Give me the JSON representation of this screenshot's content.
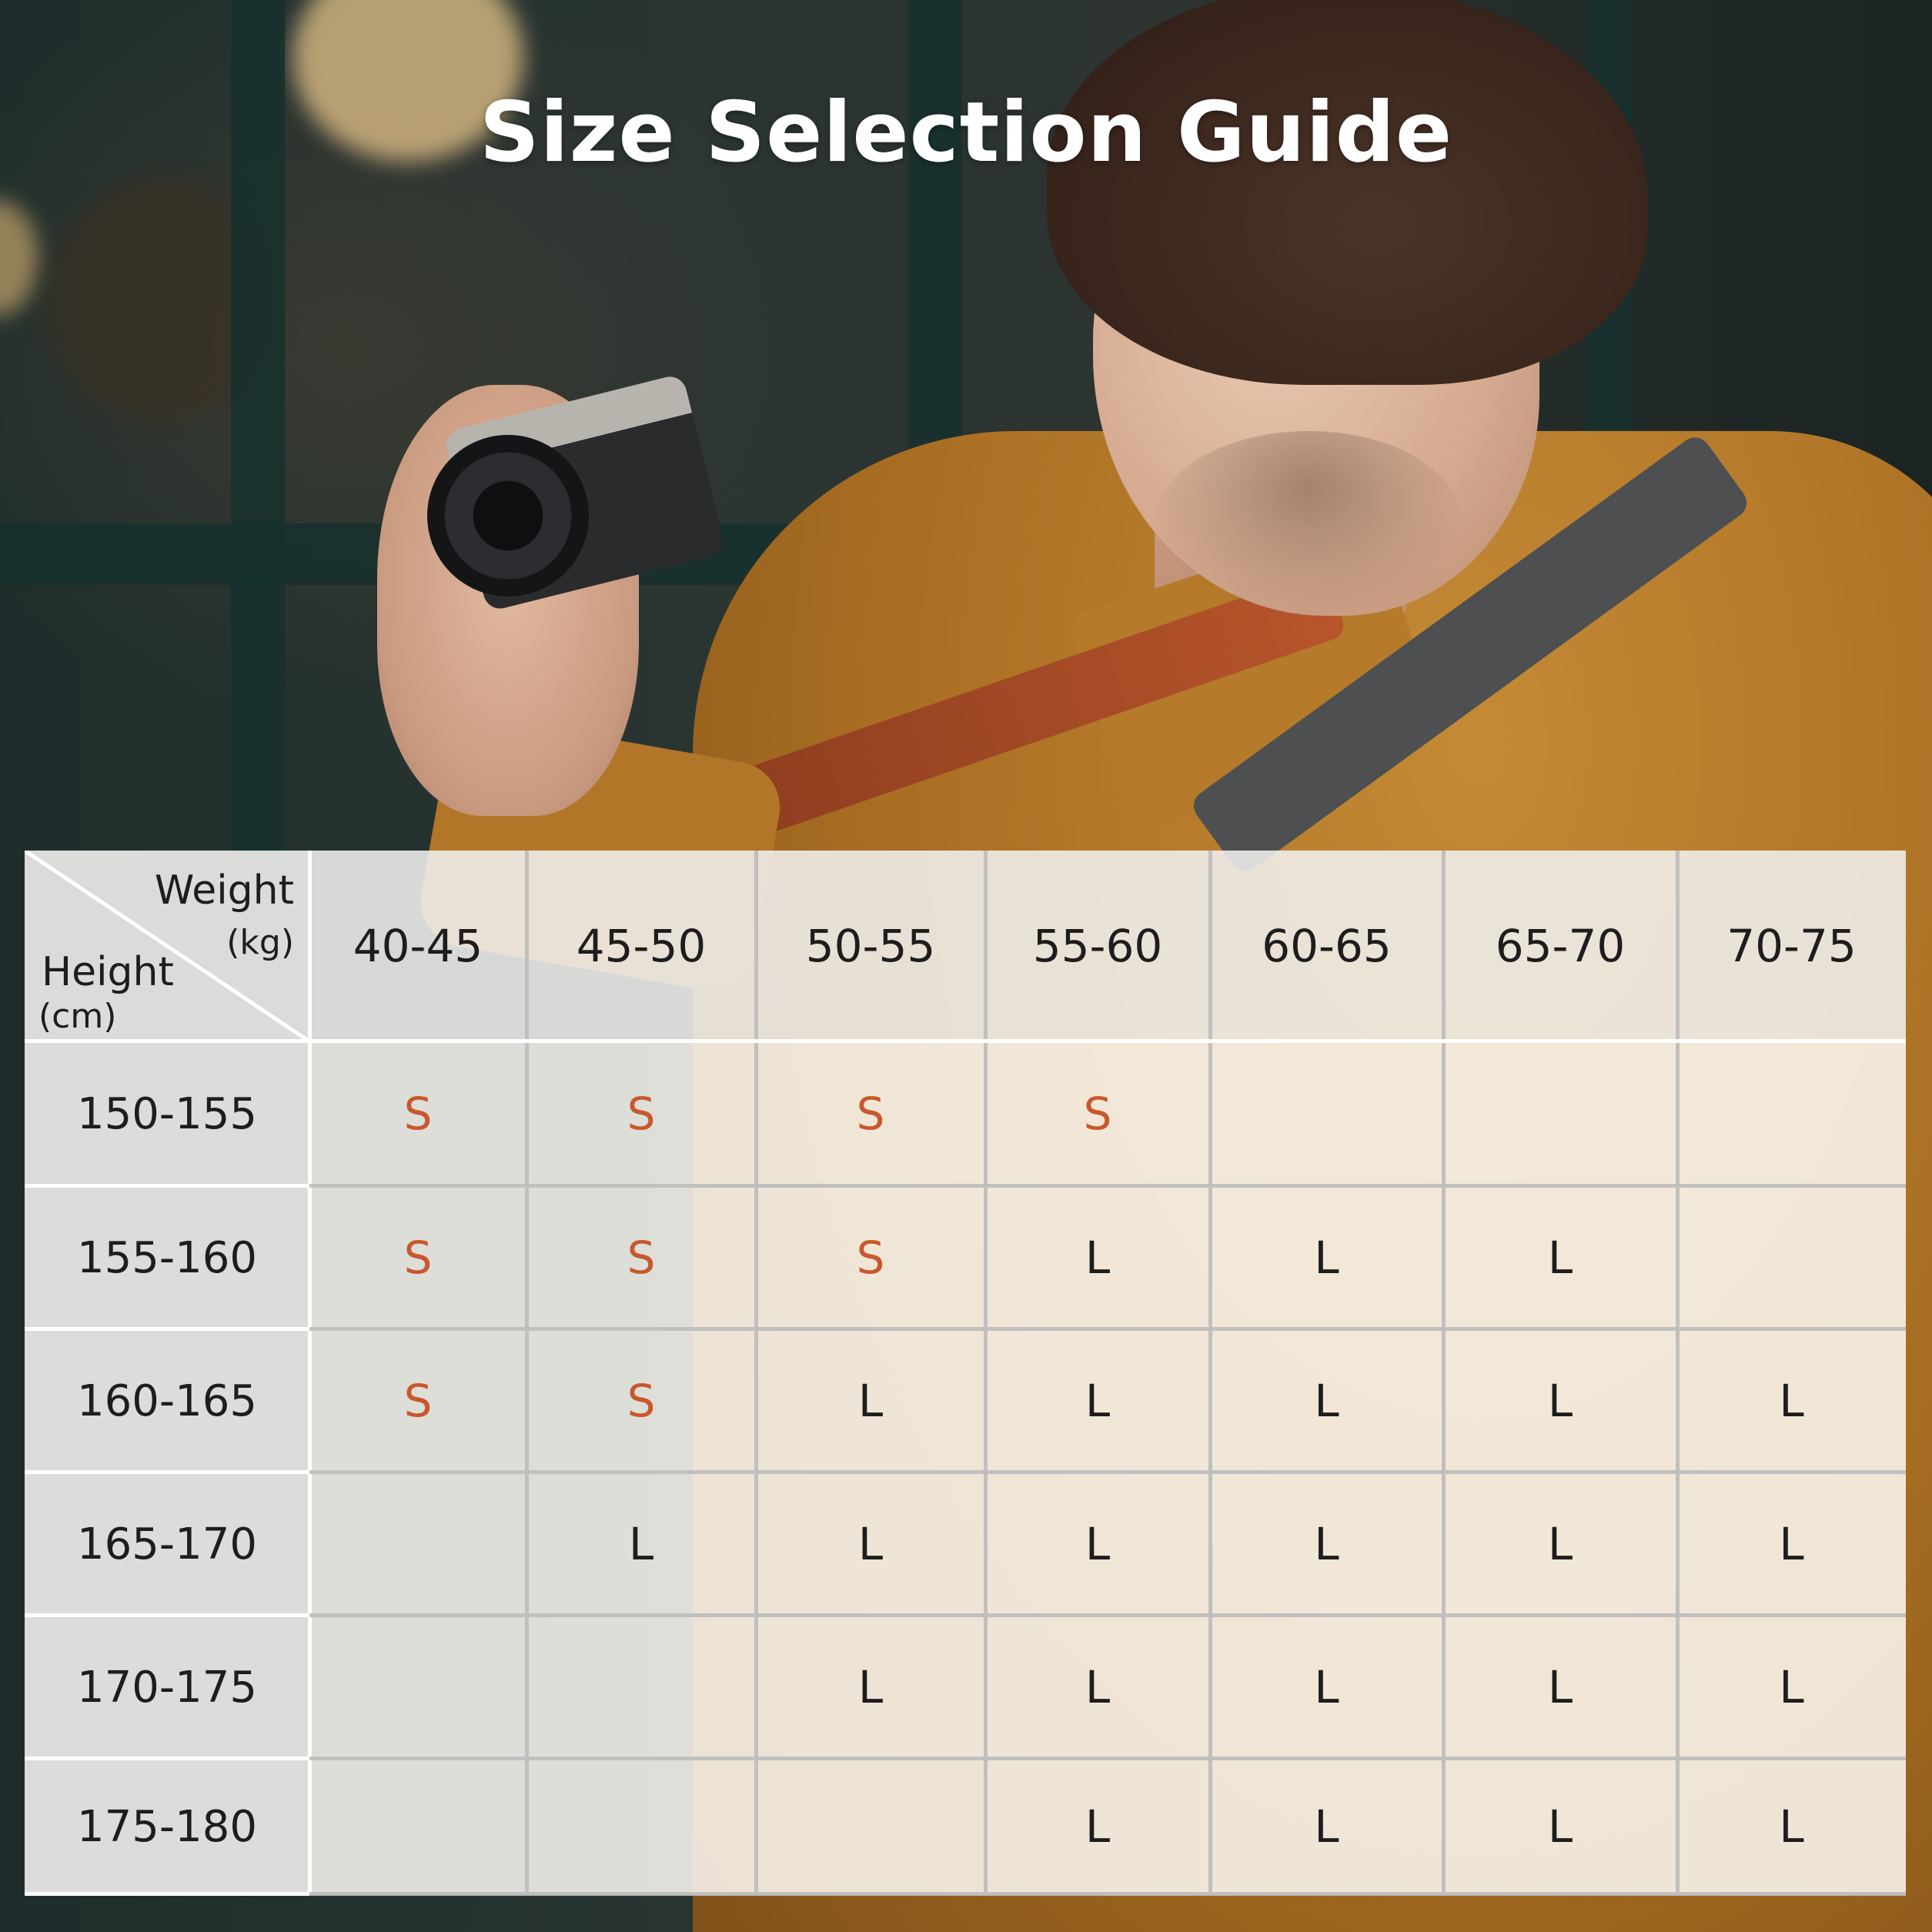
{
  "title": "Size Selection Guide",
  "corner": {
    "weight_label": "Weight",
    "weight_unit": "(kg)",
    "height_label": "Height",
    "height_unit": "(cm)"
  },
  "weight_ranges": [
    "40-45",
    "45-50",
    "50-55",
    "55-60",
    "60-65",
    "65-70",
    "70-75"
  ],
  "rows": [
    {
      "height": "150-155",
      "sizes": [
        "S",
        "S",
        "S",
        "S",
        "",
        "",
        ""
      ]
    },
    {
      "height": "155-160",
      "sizes": [
        "S",
        "S",
        "S",
        "L",
        "L",
        "L",
        ""
      ]
    },
    {
      "height": "160-165",
      "sizes": [
        "S",
        "S",
        "L",
        "L",
        "L",
        "L",
        "L"
      ]
    },
    {
      "height": "165-170",
      "sizes": [
        "",
        "L",
        "L",
        "L",
        "L",
        "L",
        "L"
      ]
    },
    {
      "height": "170-175",
      "sizes": [
        "",
        "",
        "L",
        "L",
        "L",
        "L",
        "L"
      ]
    },
    {
      "height": "175-180",
      "sizes": [
        "",
        "",
        "",
        "L",
        "L",
        "L",
        "L"
      ]
    }
  ],
  "colors": {
    "size_s": "#c8582d",
    "size_l": "#1d1d1d"
  }
}
